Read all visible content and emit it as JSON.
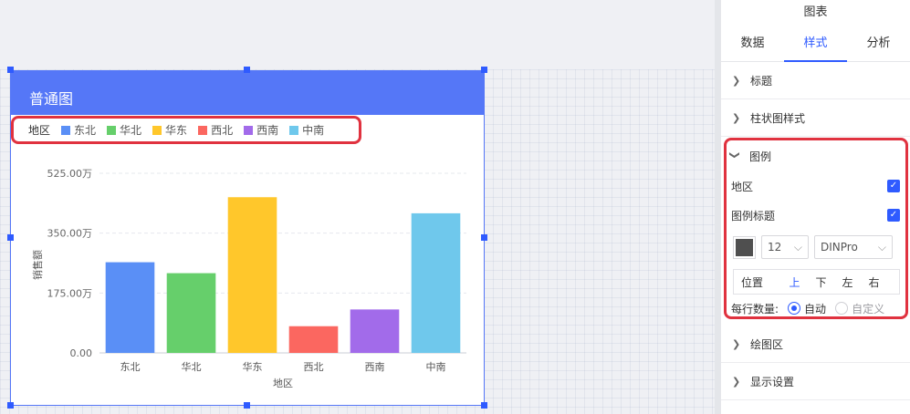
{
  "canvas": {
    "widget_title": "普通图",
    "legend": {
      "title": "地区",
      "items": [
        {
          "label": "东北",
          "color": "#5a8ff6"
        },
        {
          "label": "华北",
          "color": "#66cf6b"
        },
        {
          "label": "华东",
          "color": "#ffc72b"
        },
        {
          "label": "西北",
          "color": "#fb6760"
        },
        {
          "label": "西南",
          "color": "#a26bea"
        },
        {
          "label": "中南",
          "color": "#6fc8ec"
        }
      ]
    }
  },
  "chart_data": {
    "type": "bar",
    "categories": [
      "东北",
      "华北",
      "华东",
      "西北",
      "西南",
      "中南"
    ],
    "values": [
      2650000,
      2330000,
      4550000,
      780000,
      1270000,
      4080000
    ],
    "colors": [
      "#5a8ff6",
      "#66cf6b",
      "#ffc72b",
      "#fb6760",
      "#a26bea",
      "#6fc8ec"
    ],
    "ylim": [
      0,
      5250000
    ],
    "yticks": [
      0,
      1750000,
      3500000,
      5250000
    ],
    "ytick_labels": [
      "0.00",
      "175.00万",
      "350.00万",
      "525.00万"
    ],
    "xlabel": "地区",
    "ylabel": "销售额",
    "grid": true
  },
  "panel": {
    "title": "图表",
    "tabs": [
      "数据",
      "样式",
      "分析"
    ],
    "active_tab": "样式",
    "sections_top": [
      "标题",
      "柱状图样式"
    ],
    "legend_section": {
      "label": "图例",
      "show_label": "地区",
      "title_label": "图例标题",
      "font_size": "12",
      "font_family": "DINPro",
      "position_label": "位置",
      "positions": [
        "上",
        "下",
        "左",
        "右"
      ],
      "active_position": "上",
      "count_label": "每行数量:",
      "count_auto": "自动",
      "count_custom": "自定义"
    },
    "sections_bottom": [
      "绘图区",
      "显示设置"
    ]
  }
}
